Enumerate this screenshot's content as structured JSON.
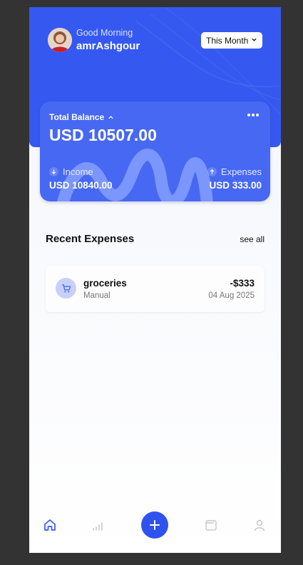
{
  "header": {
    "greeting": "Good Morning",
    "username": "amrAshgour",
    "period_select": {
      "value": "This Month"
    }
  },
  "balance_card": {
    "label": "Total Balance",
    "balance": "USD 10507.00",
    "income": {
      "label": "Income",
      "value": "USD 10840.00"
    },
    "expenses": {
      "label": "Expenses",
      "value": "USD 333.00"
    }
  },
  "recent": {
    "title": "Recent Expenses",
    "see_all": "see all",
    "items": [
      {
        "name": "groceries",
        "source": "Manual",
        "amount": "-$333",
        "date": "04 Aug 2025",
        "icon": "cart-icon"
      }
    ]
  },
  "nav": {
    "items": [
      {
        "icon": "home-icon",
        "active": true
      },
      {
        "icon": "stats-icon",
        "active": false
      },
      {
        "icon": "plus-icon",
        "active": false
      },
      {
        "icon": "wallet-icon",
        "active": false
      },
      {
        "icon": "profile-icon",
        "active": false
      }
    ]
  },
  "colors": {
    "primary": "#3559f0",
    "card": "#4768f3",
    "page_bg": "#f3f5fb",
    "nav_inactive": "#c8c8c8"
  }
}
